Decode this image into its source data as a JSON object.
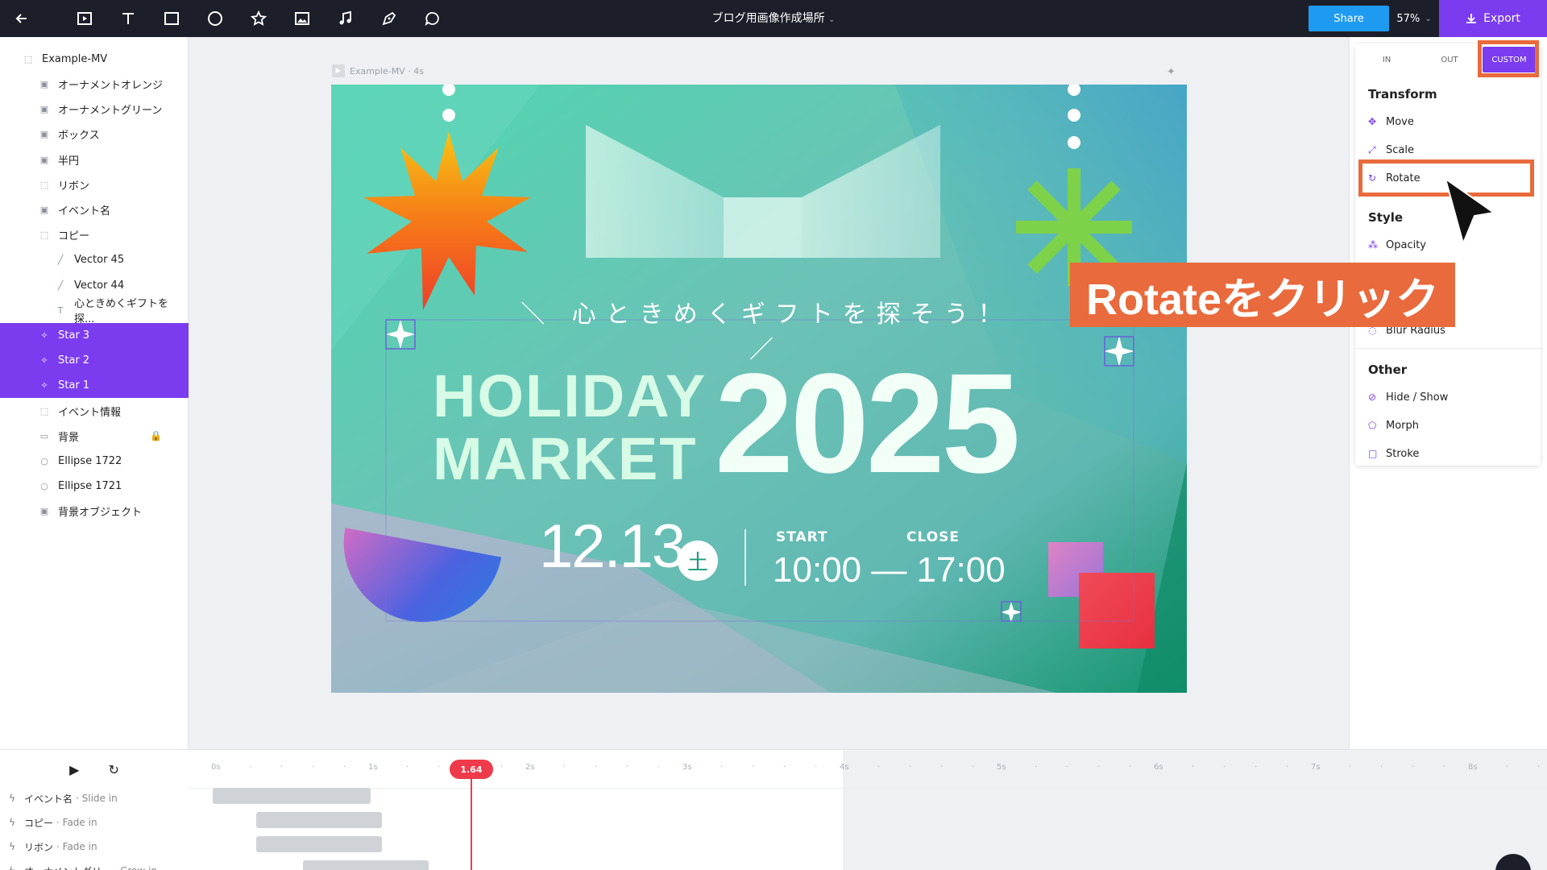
{
  "topbar": {
    "back_icon": "arrow-left-icon",
    "tools": [
      "frame-tool-icon",
      "text-tool-icon",
      "rectangle-tool-icon",
      "ellipse-tool-icon",
      "star-tool-icon",
      "image-tool-icon",
      "music-tool-icon",
      "pen-tool-icon",
      "comment-tool-icon"
    ],
    "title": "ブログ用画像作成場所",
    "title_caret": "⌄",
    "share_label": "Share",
    "zoom": "57%",
    "zoom_caret": "⌄",
    "export_label": "Export"
  },
  "layers": {
    "root": "Example-MV",
    "items": [
      {
        "label": "オーナメントオレンジ",
        "icon": "image-icon"
      },
      {
        "label": "オーナメントグリーン",
        "icon": "image-icon"
      },
      {
        "label": "ボックス",
        "icon": "image-icon"
      },
      {
        "label": "半円",
        "icon": "image-icon"
      },
      {
        "label": "リボン",
        "icon": "group-icon"
      },
      {
        "label": "イベント名",
        "icon": "image-icon"
      },
      {
        "label": "コピー",
        "icon": "group-icon"
      },
      {
        "label": "Vector 45",
        "icon": "vector-icon"
      },
      {
        "label": "Vector 44",
        "icon": "vector-icon"
      },
      {
        "label": "心ときめくギフトを探...",
        "icon": "text-icon"
      },
      {
        "label": "Star 3",
        "icon": "star-icon",
        "selected": true
      },
      {
        "label": "Star 2",
        "icon": "star-icon",
        "selected": true
      },
      {
        "label": "Star 1",
        "icon": "star-icon",
        "selected": true
      },
      {
        "label": "イベント情報",
        "icon": "group-icon"
      },
      {
        "label": "背景",
        "icon": "rect-icon",
        "locked": true
      },
      {
        "label": "Ellipse 1722",
        "icon": "ellipse-icon"
      },
      {
        "label": "Ellipse 1721",
        "icon": "ellipse-icon"
      },
      {
        "label": "背景オブジェクト",
        "icon": "image-icon"
      }
    ]
  },
  "canvas": {
    "frame_label": "Example-MV · 4s",
    "artboard": {
      "tagline": "＼ 心ときめくギフトを探そう！ ／",
      "holiday": "HOLIDAY",
      "market": "MARKET",
      "year": "2025",
      "date": "12.13",
      "day": "土",
      "start_label": "START",
      "close_label": "CLOSE",
      "times": "10:00 — 17:00"
    }
  },
  "panel": {
    "tabs": [
      "IN",
      "OUT",
      "CUSTOM"
    ],
    "sections": {
      "transform": "Transform",
      "style": "Style",
      "other": "Other"
    },
    "options": {
      "move": "Move",
      "scale": "Scale",
      "rotate": "Rotate",
      "opacity": "Opacity",
      "blur": "Blur Radius",
      "hide": "Hide / Show",
      "morph": "Morph",
      "stroke": "Stroke"
    },
    "accent": "#7b3cf0"
  },
  "annotation": {
    "callout": "Rotateをクリック",
    "highlight_color": "#e96a3c"
  },
  "timeline": {
    "ticks": [
      "0s",
      "1s",
      "2s",
      "3s",
      "4s",
      "5s",
      "6s",
      "7s",
      "8s"
    ],
    "playhead": "1.64",
    "tracks": [
      {
        "label": "イベント名",
        "effect": "· Slide in"
      },
      {
        "label": "コピー",
        "effect": "· Fade in"
      },
      {
        "label": "リボン",
        "effect": "· Fade in"
      },
      {
        "label": "オーナメントグリ...",
        "effect": "· Grow in"
      }
    ]
  }
}
